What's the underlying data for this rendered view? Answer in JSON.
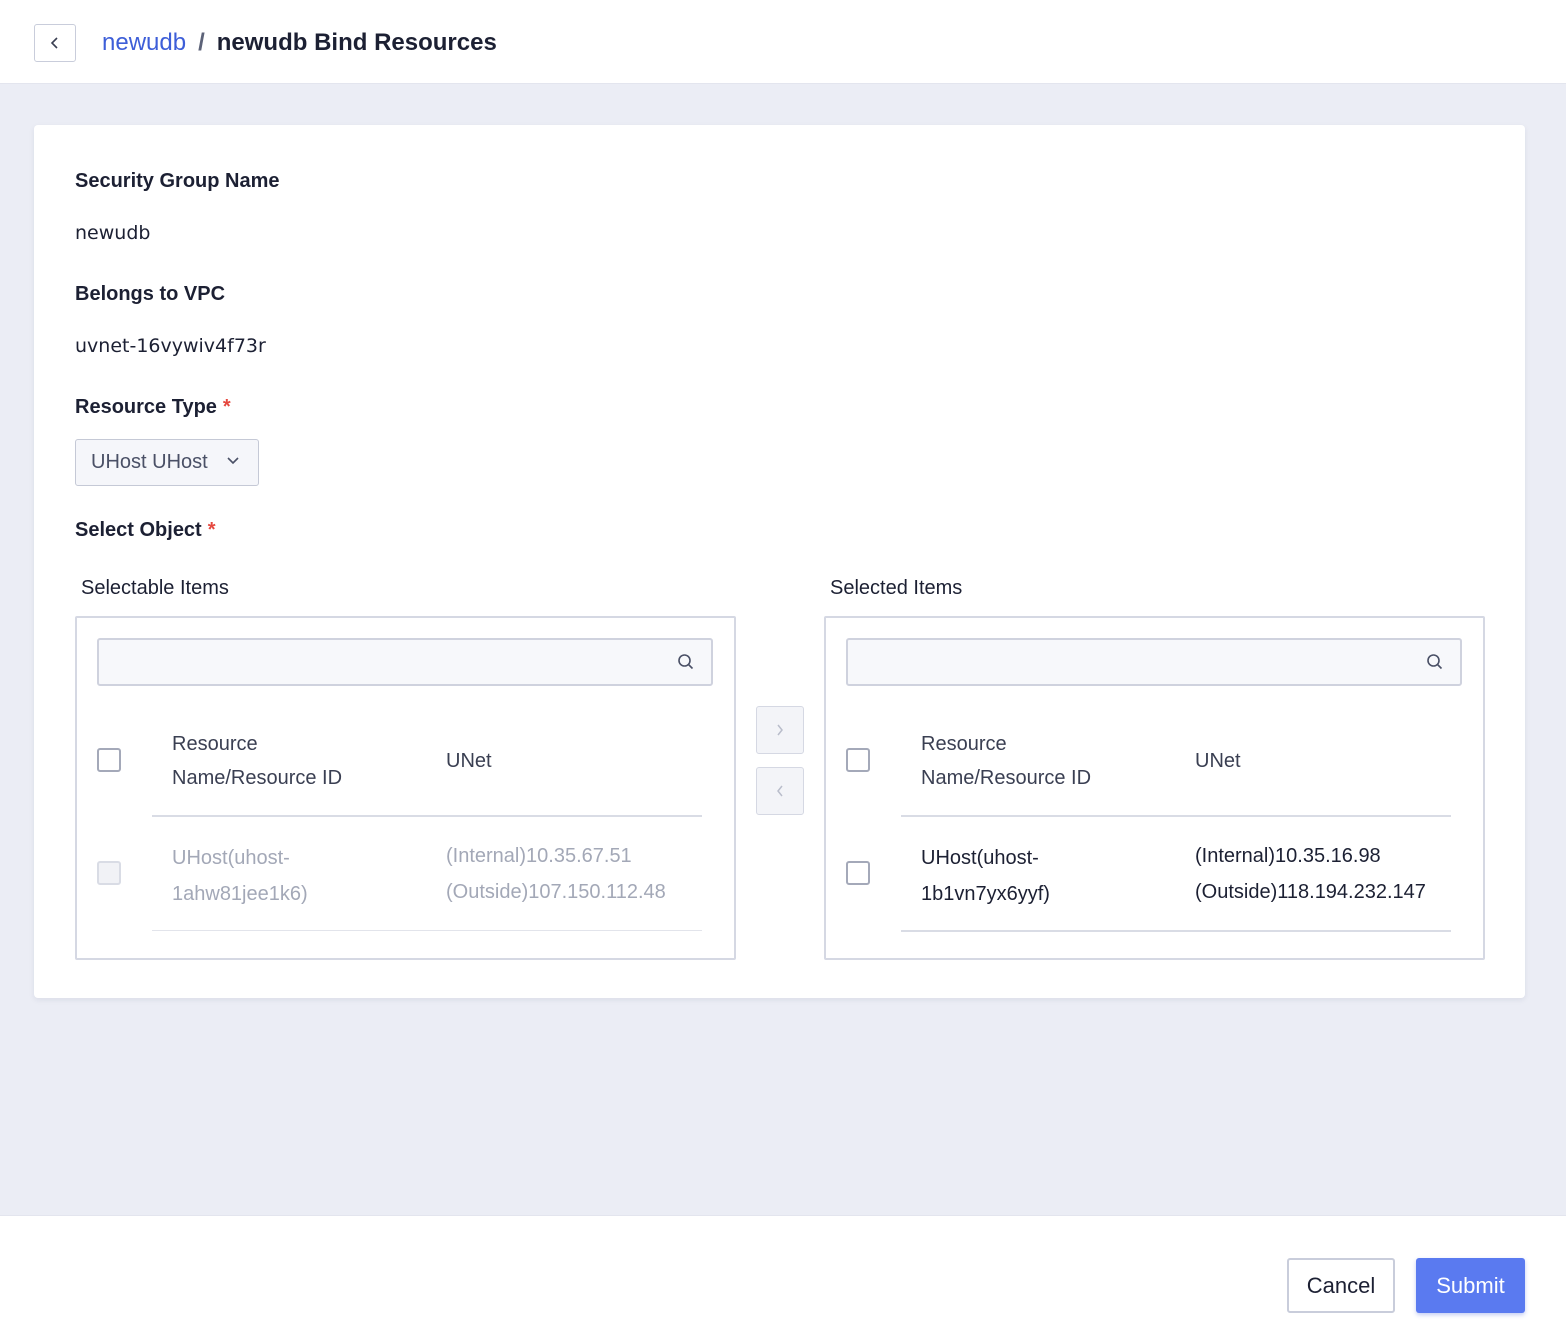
{
  "header": {
    "breadcrumb_parent": "newudb",
    "separator": "/",
    "title": "newudb Bind Resources"
  },
  "form": {
    "security_group_label": "Security Group Name",
    "security_group_value": "newudb",
    "vpc_label": "Belongs to VPC",
    "vpc_value": "uvnet-16vywiv4f73r",
    "resource_type_label": "Resource Type",
    "resource_type_value": "UHost UHost",
    "select_object_label": "Select Object",
    "required_mark": "*"
  },
  "transfer": {
    "left": {
      "title": "Selectable Items",
      "search_placeholder": "",
      "col_name_line1": "Resource",
      "col_name_line2": "Name/Resource ID",
      "col_unet": "UNet",
      "rows": [
        {
          "name_line1": "UHost(uhost-",
          "name_line2": "1ahw81jee1k6)",
          "unet_line1": "(Internal)10.35.67.51",
          "unet_line2": "(Outside)107.150.112.48",
          "disabled": true
        }
      ]
    },
    "right": {
      "title": "Selected Items",
      "search_placeholder": "",
      "col_name_line1": "Resource",
      "col_name_line2": "Name/Resource ID",
      "col_unet": "UNet",
      "rows": [
        {
          "name_line1": "UHost(uhost-",
          "name_line2": "1b1vn7yx6yyf)",
          "unet_line1": "(Internal)10.35.16.98",
          "unet_line2": "(Outside)118.194.232.147",
          "disabled": false
        }
      ]
    }
  },
  "footer": {
    "cancel_label": "Cancel",
    "submit_label": "Submit"
  },
  "colors": {
    "accent": "#5a7af0",
    "link": "#3d5ed8",
    "required": "#e5483f"
  }
}
